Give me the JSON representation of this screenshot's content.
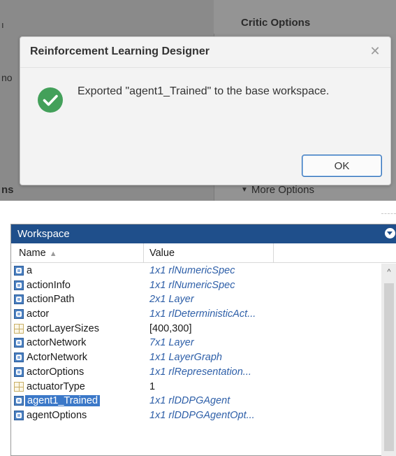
{
  "background": {
    "critic_title": "Critic Options",
    "left_fragment_top": "ı",
    "left_fragment_mid": "no",
    "left_fragment_bottom": "ns",
    "more_options_icon": "triangle-down-icon",
    "more_options": "More Options"
  },
  "dialog": {
    "title": "Reinforcement Learning Designer",
    "close_icon": "close-icon",
    "success_icon": "checkmark-circle-icon",
    "message": "Exported \"agent1_Trained\" to the base workspace.",
    "ok_label": "OK",
    "colors": {
      "success": "#43a05a",
      "ok_border": "#2f6fb8"
    }
  },
  "workspace": {
    "title": "Workspace",
    "menu_icon": "chevron-down-circle-icon",
    "columns": {
      "name": "Name",
      "name_sort": "▲",
      "value": "Value"
    },
    "colors": {
      "header_bg": "#1f4f8b",
      "value_text": "#2e5fa8",
      "selection": "#3b78c8"
    },
    "rows": [
      {
        "name": "a",
        "value": "1x1 rlNumericSpec",
        "icon": "object-icon"
      },
      {
        "name": "actionInfo",
        "value": "1x1 rlNumericSpec",
        "icon": "object-icon"
      },
      {
        "name": "actionPath",
        "value": "2x1 Layer",
        "icon": "object-icon"
      },
      {
        "name": "actor",
        "value": "1x1 rlDeterministicAct...",
        "icon": "object-icon"
      },
      {
        "name": "actorLayerSizes",
        "value": "[400,300]",
        "icon": "numeric-array-icon"
      },
      {
        "name": "actorNetwork",
        "value": "7x1 Layer",
        "icon": "object-icon"
      },
      {
        "name": "ActorNetwork",
        "value": "1x1 LayerGraph",
        "icon": "object-icon"
      },
      {
        "name": "actorOptions",
        "value": "1x1 rlRepresentation...",
        "icon": "object-icon"
      },
      {
        "name": "actuatorType",
        "value": "1",
        "icon": "numeric-array-icon"
      },
      {
        "name": "agent1_Trained",
        "value": "1x1 rlDDPGAgent",
        "icon": "object-icon",
        "selected": true
      },
      {
        "name": "agentOptions",
        "value": "1x1 rlDDPGAgentOpt...",
        "icon": "object-icon"
      }
    ],
    "scroll_up_icon": "scroll-up-arrow-icon"
  }
}
